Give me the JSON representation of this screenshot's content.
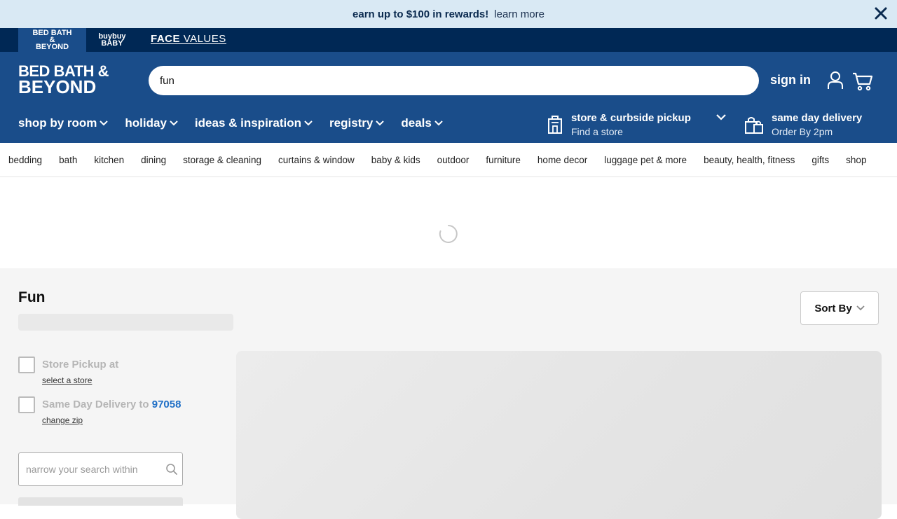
{
  "promo": {
    "headline": "earn up to $100 in rewards!",
    "link": "learn more"
  },
  "brands": [
    {
      "line1": "BED BATH &",
      "line2": "BEYOND"
    },
    {
      "line1": "buybuy",
      "line2": "BABY"
    },
    {
      "line1": "FACE",
      "line2": "VALUES"
    }
  ],
  "header": {
    "logo_line1": "BED BATH &",
    "logo_line2": "BEYOND",
    "search_value": "fun",
    "signin": "sign in",
    "nav": [
      "shop by room",
      "holiday",
      "ideas & inspiration",
      "registry",
      "deals"
    ],
    "store": {
      "title": "store & curbside pickup",
      "sub": "Find a store"
    },
    "sameday": {
      "title": "same day delivery",
      "sub": "Order By 2pm"
    }
  },
  "categories": [
    "bedding",
    "bath",
    "kitchen",
    "dining",
    "storage & cleaning",
    "curtains & window",
    "baby & kids",
    "outdoor",
    "furniture",
    "home decor",
    "luggage pet & more",
    "beauty, health, fitness",
    "gifts",
    "shop"
  ],
  "main": {
    "title": "Fun",
    "sort_label": "Sort By",
    "store_pickup": {
      "label": "Store Pickup at",
      "link": "select a store"
    },
    "same_day": {
      "label": "Same Day Delivery to",
      "zip": "97058",
      "link": "change zip"
    },
    "narrow_placeholder": "narrow your search within"
  },
  "colors": {
    "promo_bg": "#d9e9f4",
    "brandbar_bg": "#002855",
    "header_bg": "#1a4d8a",
    "zip_link": "#1f6fc6"
  }
}
